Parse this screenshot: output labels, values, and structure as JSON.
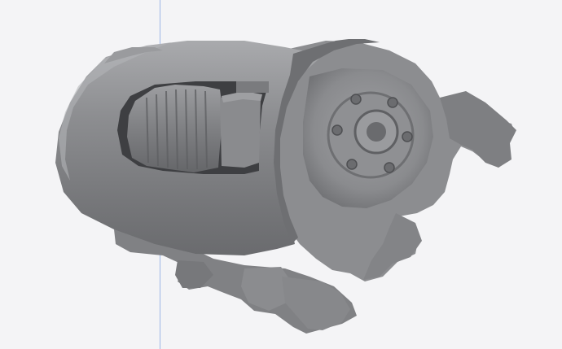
{
  "viewport": {
    "background_color": "#f4f4f6",
    "axis_guide_color": "#9fb8e6",
    "model": {
      "description_icon": "3d-scan-mesh",
      "shade_base": "#8f9093",
      "shade_dark": "#5a5b5e",
      "shade_light": "#c7c8cb"
    }
  }
}
